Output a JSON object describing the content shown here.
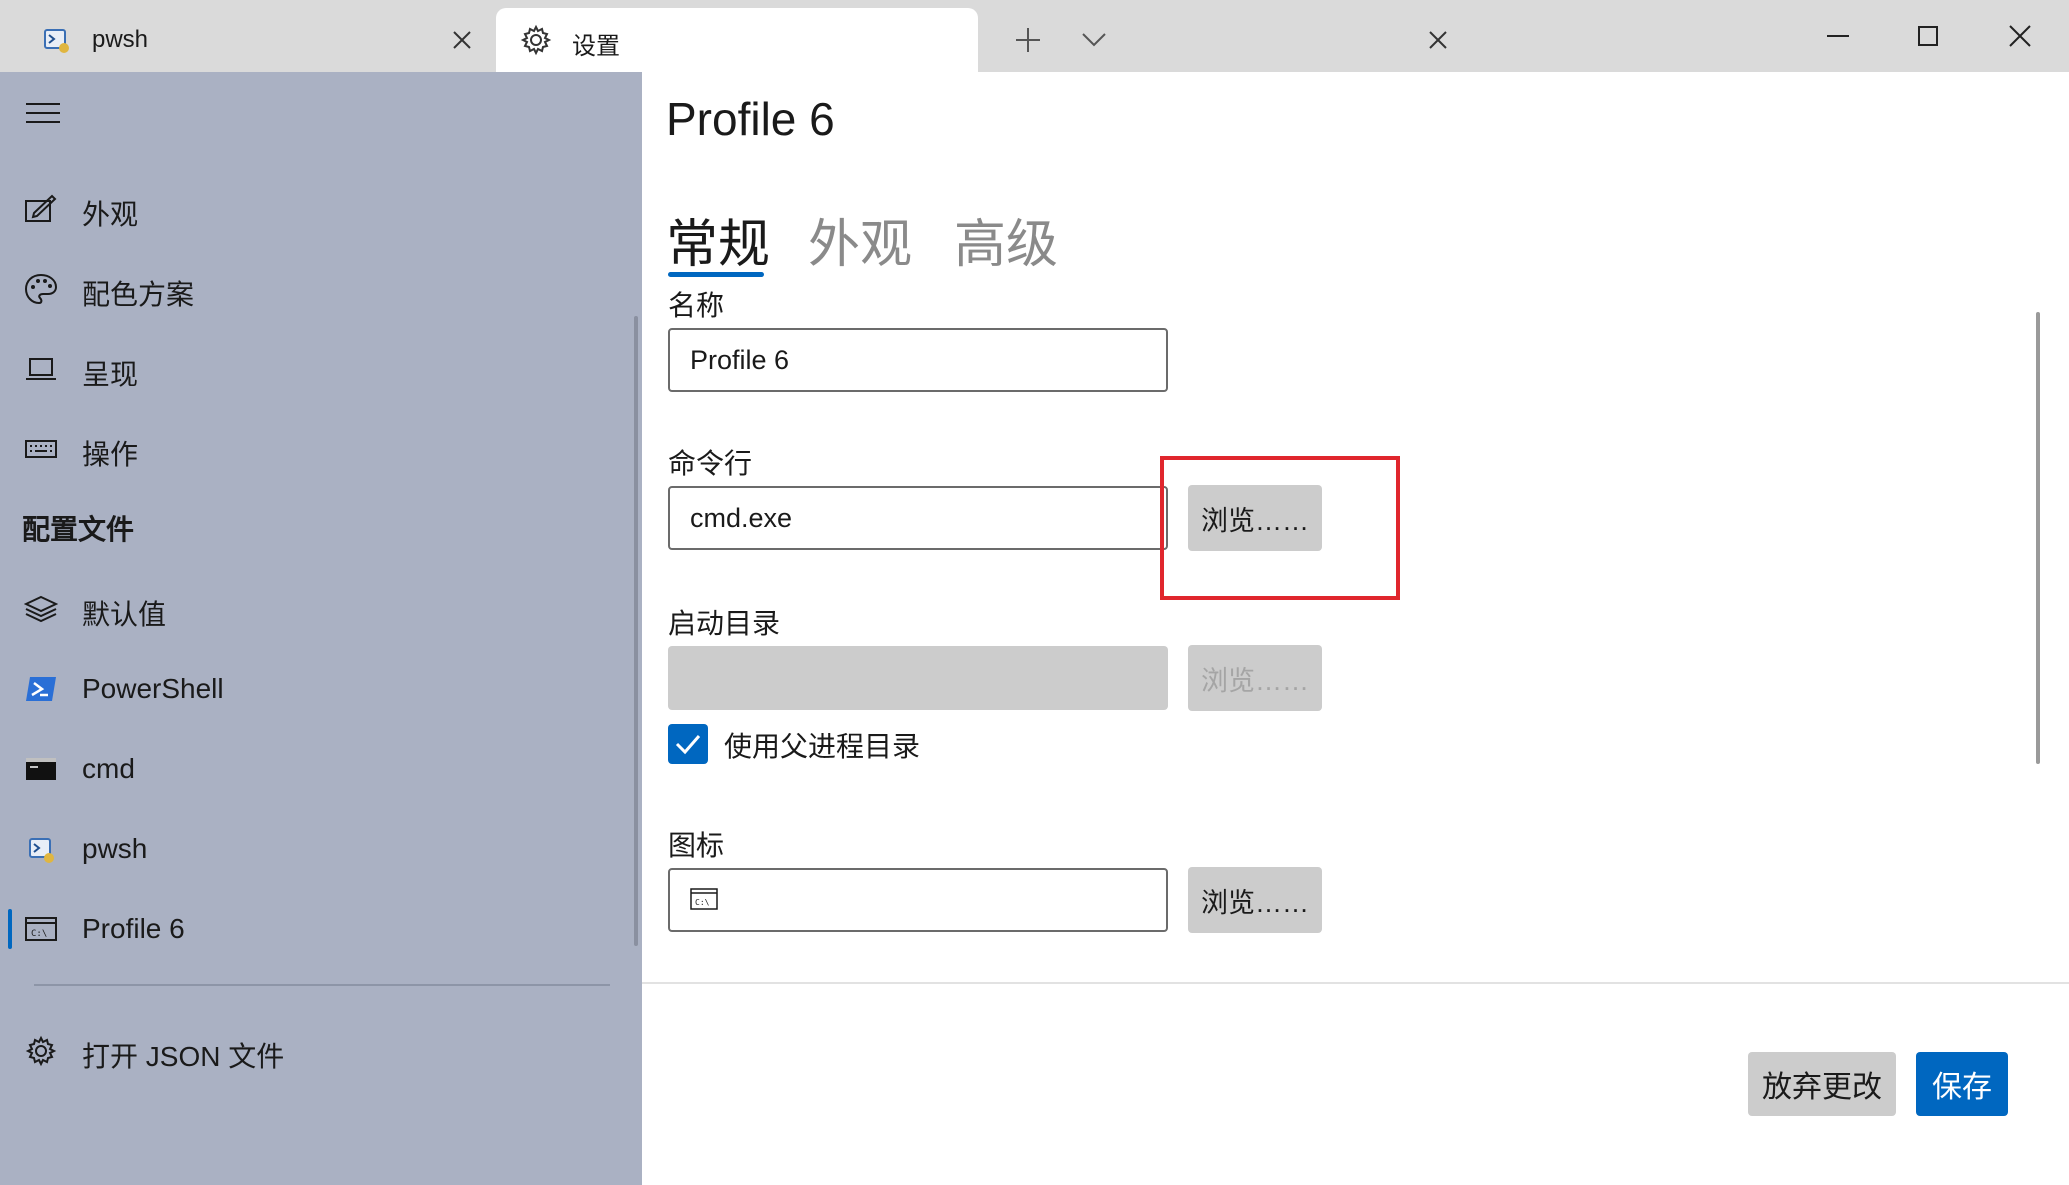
{
  "tabs": [
    {
      "label": "pwsh",
      "icon": "pwsh-icon"
    },
    {
      "label": "设置",
      "icon": "gear-icon"
    }
  ],
  "sidebar": {
    "items": [
      {
        "label": "外观",
        "icon": "appearance-icon"
      },
      {
        "label": "配色方案",
        "icon": "palette-icon"
      },
      {
        "label": "呈现",
        "icon": "rendering-icon"
      },
      {
        "label": "操作",
        "icon": "keyboard-icon"
      }
    ],
    "section_title": "配置文件",
    "profiles": [
      {
        "label": "默认值",
        "icon": "layers-icon"
      },
      {
        "label": "PowerShell",
        "icon": "powershell-icon"
      },
      {
        "label": "cmd",
        "icon": "cmd-icon"
      },
      {
        "label": "pwsh",
        "icon": "pwsh-icon"
      },
      {
        "label": "Profile 6",
        "icon": "terminal-icon",
        "selected": true
      }
    ],
    "open_json": {
      "label": "打开 JSON 文件",
      "icon": "gear-icon"
    }
  },
  "main": {
    "title": "Profile 6",
    "tabs": [
      {
        "label": "常规",
        "selected": true
      },
      {
        "label": "外观",
        "selected": false
      },
      {
        "label": "高级",
        "selected": false
      }
    ],
    "name": {
      "label": "名称",
      "value": "Profile 6"
    },
    "command_line": {
      "label": "命令行",
      "value": "cmd.exe",
      "browse": "浏览……"
    },
    "starting_directory": {
      "label": "启动目录",
      "value": "",
      "browse": "浏览……",
      "use_parent_label": "使用父进程目录",
      "use_parent_checked": true
    },
    "icon_field": {
      "label": "图标",
      "value": "",
      "browse": "浏览……"
    },
    "footer": {
      "discard": "放弃更改",
      "save": "保存"
    }
  },
  "colors": {
    "accent": "#0067c0",
    "sidebar_bg": "#aab1c3",
    "highlight": "#e0262d"
  }
}
